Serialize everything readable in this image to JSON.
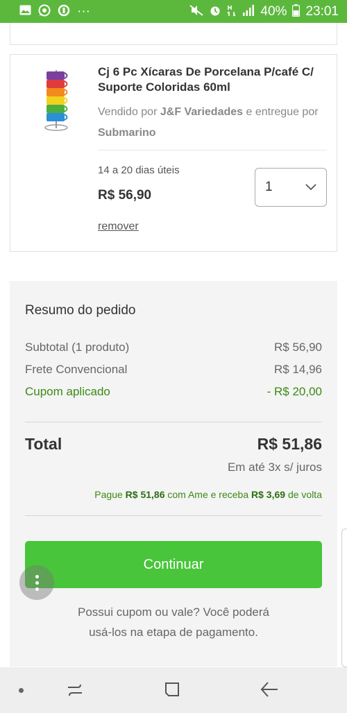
{
  "status_bar": {
    "icons_left": [
      "image-icon",
      "whatsapp-icon",
      "data-saver-icon",
      "more-dots-icon"
    ],
    "icons_right": [
      "mute-vibrate-icon",
      "alarm-icon",
      "network-icon",
      "signal-icon"
    ],
    "battery": "40%",
    "time": "23:01"
  },
  "product": {
    "title": "Cj 6 Pc Xícaras De Porcelana P/café C/ Suporte Coloridas 60ml",
    "seller_prefix": "Vendido por ",
    "seller_name": "J&F Variedades",
    "delivered_prefix": " e entregue por ",
    "delivered_by": "Submarino",
    "delivery_time": "14 a 20 dias úteis",
    "price": "R$ 56,90",
    "quantity": "1",
    "remove_label": "remover",
    "cup_colors": [
      "#7b3fa0",
      "#e23b3b",
      "#f28b1e",
      "#f3d21e",
      "#4cae3e",
      "#2a8fd6"
    ]
  },
  "summary": {
    "title": "Resumo do pedido",
    "subtotal_label": "Subtotal (1 produto)",
    "subtotal_value": "R$ 56,90",
    "shipping_label": "Frete Convencional",
    "shipping_value": "R$ 14,96",
    "coupon_label": "Cupom aplicado",
    "coupon_value": "- R$ 20,00",
    "total_label": "Total",
    "total_value": "R$ 51,86",
    "installments": "Em até 3x s/ juros",
    "ame_prefix": "Pague ",
    "ame_amount": "R$ 51,86",
    "ame_middle": " com Ame e receba ",
    "ame_cashback": "R$ 3,69",
    "ame_suffix": " de volta",
    "continue_label": "Continuar",
    "hint_line1": "Possui cupom ou vale? Você poderá",
    "hint_line2": "usá-los na etapa de pagamento."
  },
  "nav_bar": {
    "buttons": [
      "recent-apps-icon",
      "home-icon",
      "back-icon"
    ]
  }
}
